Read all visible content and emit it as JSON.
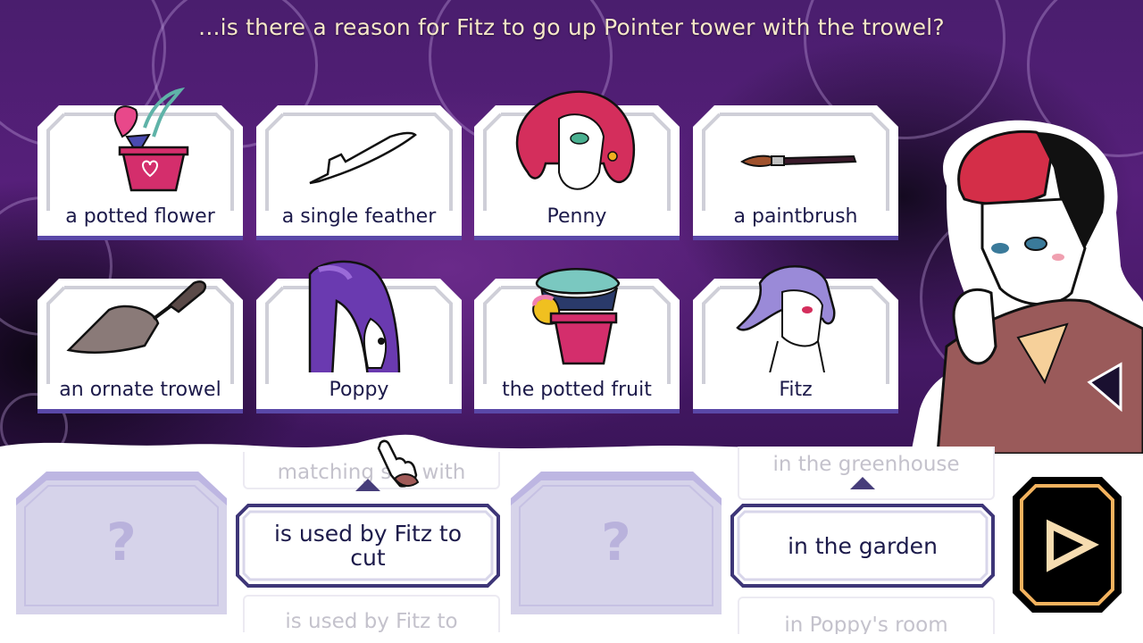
{
  "question": "...is there a reason for Fitz to go up Pointer tower with the trowel?",
  "colors": {
    "background_purple": "#4a1e6e",
    "card_text": "#1c1a4a",
    "question_text": "#f6e8c8",
    "accent_dark_purple": "#463d7a",
    "slot_fill": "#d6d3ea",
    "play_border": "#f2b25e",
    "play_icon": "#f6dcb0"
  },
  "cards": [
    {
      "label": "a potted flower",
      "icon": "potted-flower-icon"
    },
    {
      "label": "a single feather",
      "icon": "feather-icon"
    },
    {
      "label": "Penny",
      "icon": "penny-portrait-icon"
    },
    {
      "label": "a paintbrush",
      "icon": "paintbrush-icon"
    },
    {
      "label": "an ornate trowel",
      "icon": "trowel-icon"
    },
    {
      "label": "Poppy",
      "icon": "poppy-portrait-icon"
    },
    {
      "label": "the potted fruit",
      "icon": "potted-fruit-icon"
    },
    {
      "label": "Fitz",
      "icon": "fitz-portrait-icon"
    }
  ],
  "sentence": {
    "slot1": {
      "placeholder": "?"
    },
    "picker1": {
      "previous": "matching sox with",
      "selected": "is used by Fitz to cut",
      "next": "is used by Fitz to"
    },
    "slot2": {
      "placeholder": "?"
    },
    "picker2": {
      "previous": "in the greenhouse",
      "selected": "in the garden",
      "next": "in Poppy's room"
    }
  },
  "submit": {
    "icon": "play-icon"
  },
  "speaker": {
    "icon": "speaker-portrait-icon"
  }
}
